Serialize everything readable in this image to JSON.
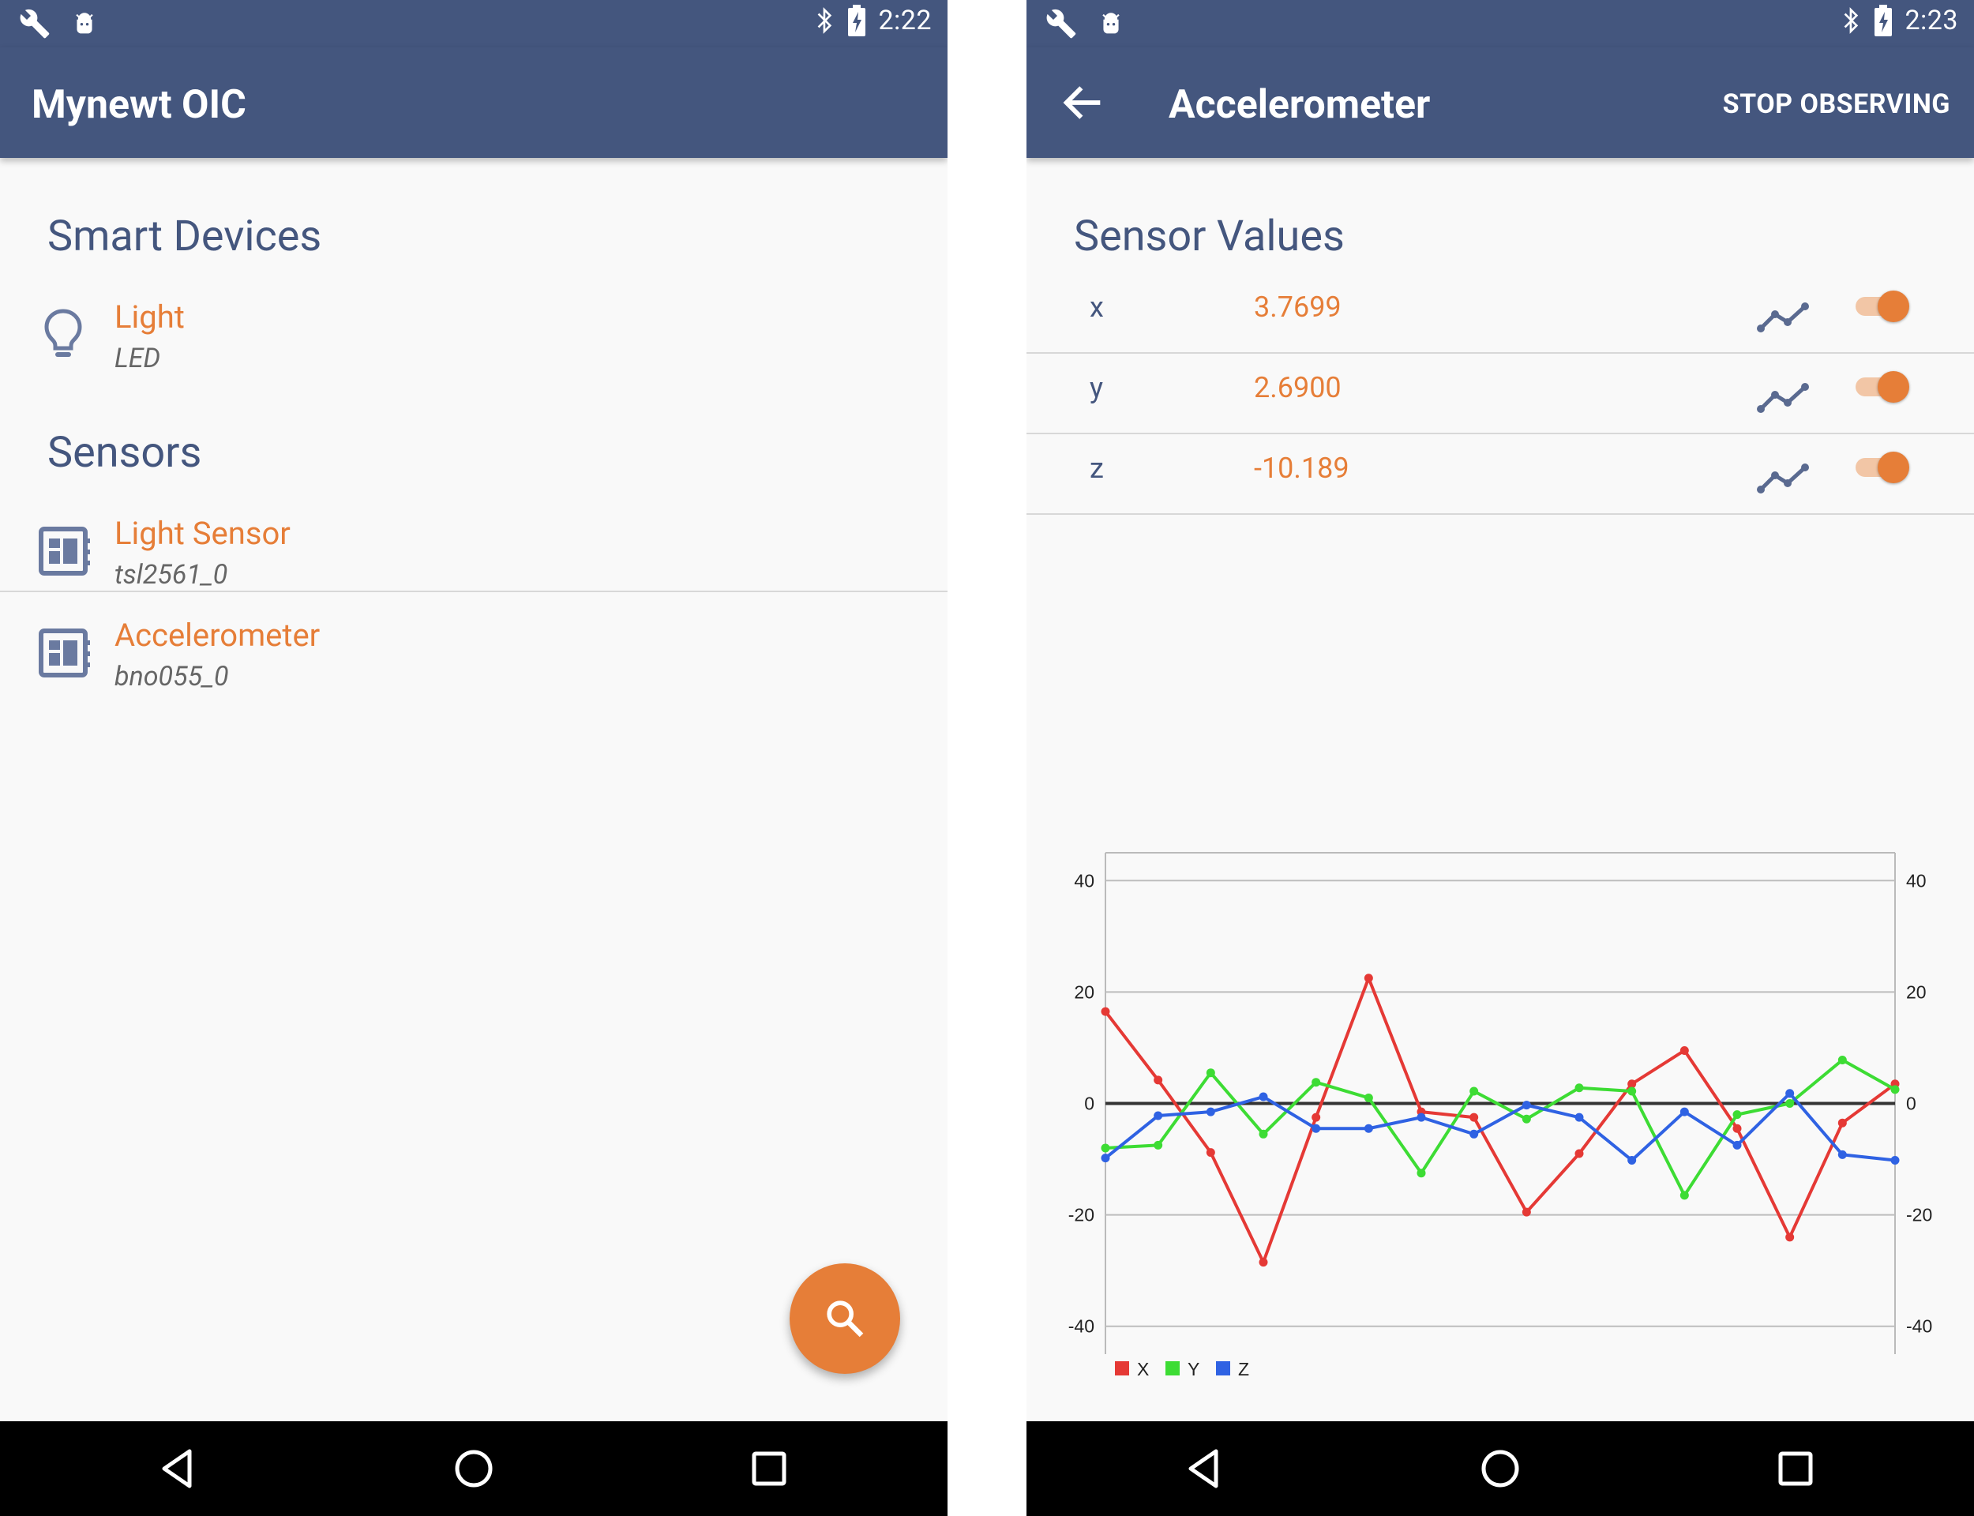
{
  "left": {
    "status": {
      "time": "2:22"
    },
    "app_title": "Mynewt OIC",
    "sections": {
      "smart_devices": {
        "header": "Smart Devices",
        "items": [
          {
            "title": "Light",
            "subtitle": "LED",
            "icon": "lightbulb-icon"
          }
        ]
      },
      "sensors": {
        "header": "Sensors",
        "items": [
          {
            "title": "Light Sensor",
            "subtitle": "tsl2561_0",
            "icon": "chip-icon"
          },
          {
            "title": "Accelerometer",
            "subtitle": "bno055_0",
            "icon": "chip-icon"
          }
        ]
      }
    },
    "fab": {
      "icon": "search-icon"
    }
  },
  "right": {
    "status": {
      "time": "2:23"
    },
    "app_title": "Accelerometer",
    "action_label": "STOP OBSERVING",
    "section_header": "Sensor Values",
    "rows": [
      {
        "axis": "x",
        "value": "3.7699",
        "enabled": true
      },
      {
        "axis": "y",
        "value": "2.6900",
        "enabled": true
      },
      {
        "axis": "z",
        "value": "-10.189",
        "enabled": true
      }
    ]
  },
  "colors": {
    "primary": "#44567e",
    "accent": "#e67e38",
    "background": "#f9f9f9",
    "x": "#e53935",
    "y": "#3ddc34",
    "z": "#2f62e3"
  },
  "chart_data": {
    "type": "line",
    "title": "",
    "xlabel": "",
    "ylabel": "",
    "ylim": [
      -45,
      45
    ],
    "yticks": [
      40,
      20,
      0,
      -20,
      -40
    ],
    "grid": true,
    "legend": "bottom-left",
    "series": [
      {
        "name": "X",
        "color": "#e53935",
        "values": [
          16.5,
          4.2,
          -8.8,
          -28.5,
          -2.5,
          22.5,
          -1.5,
          -2.5,
          -19.5,
          -9.0,
          3.5,
          9.5,
          -4.5,
          -24.0,
          -3.5,
          3.5
        ]
      },
      {
        "name": "Y",
        "color": "#3ddc34",
        "values": [
          -8.0,
          -7.5,
          5.5,
          -5.5,
          3.8,
          1.0,
          -12.5,
          2.2,
          -2.8,
          2.8,
          2.2,
          -16.5,
          -2.0,
          0.0,
          7.8,
          2.5
        ]
      },
      {
        "name": "Z",
        "color": "#2f62e3",
        "values": [
          -9.8,
          -2.2,
          -1.5,
          1.2,
          -4.5,
          -4.5,
          -2.5,
          -5.5,
          -0.3,
          -2.5,
          -10.2,
          -1.5,
          -7.5,
          1.8,
          -9.2,
          -10.2
        ]
      }
    ]
  }
}
